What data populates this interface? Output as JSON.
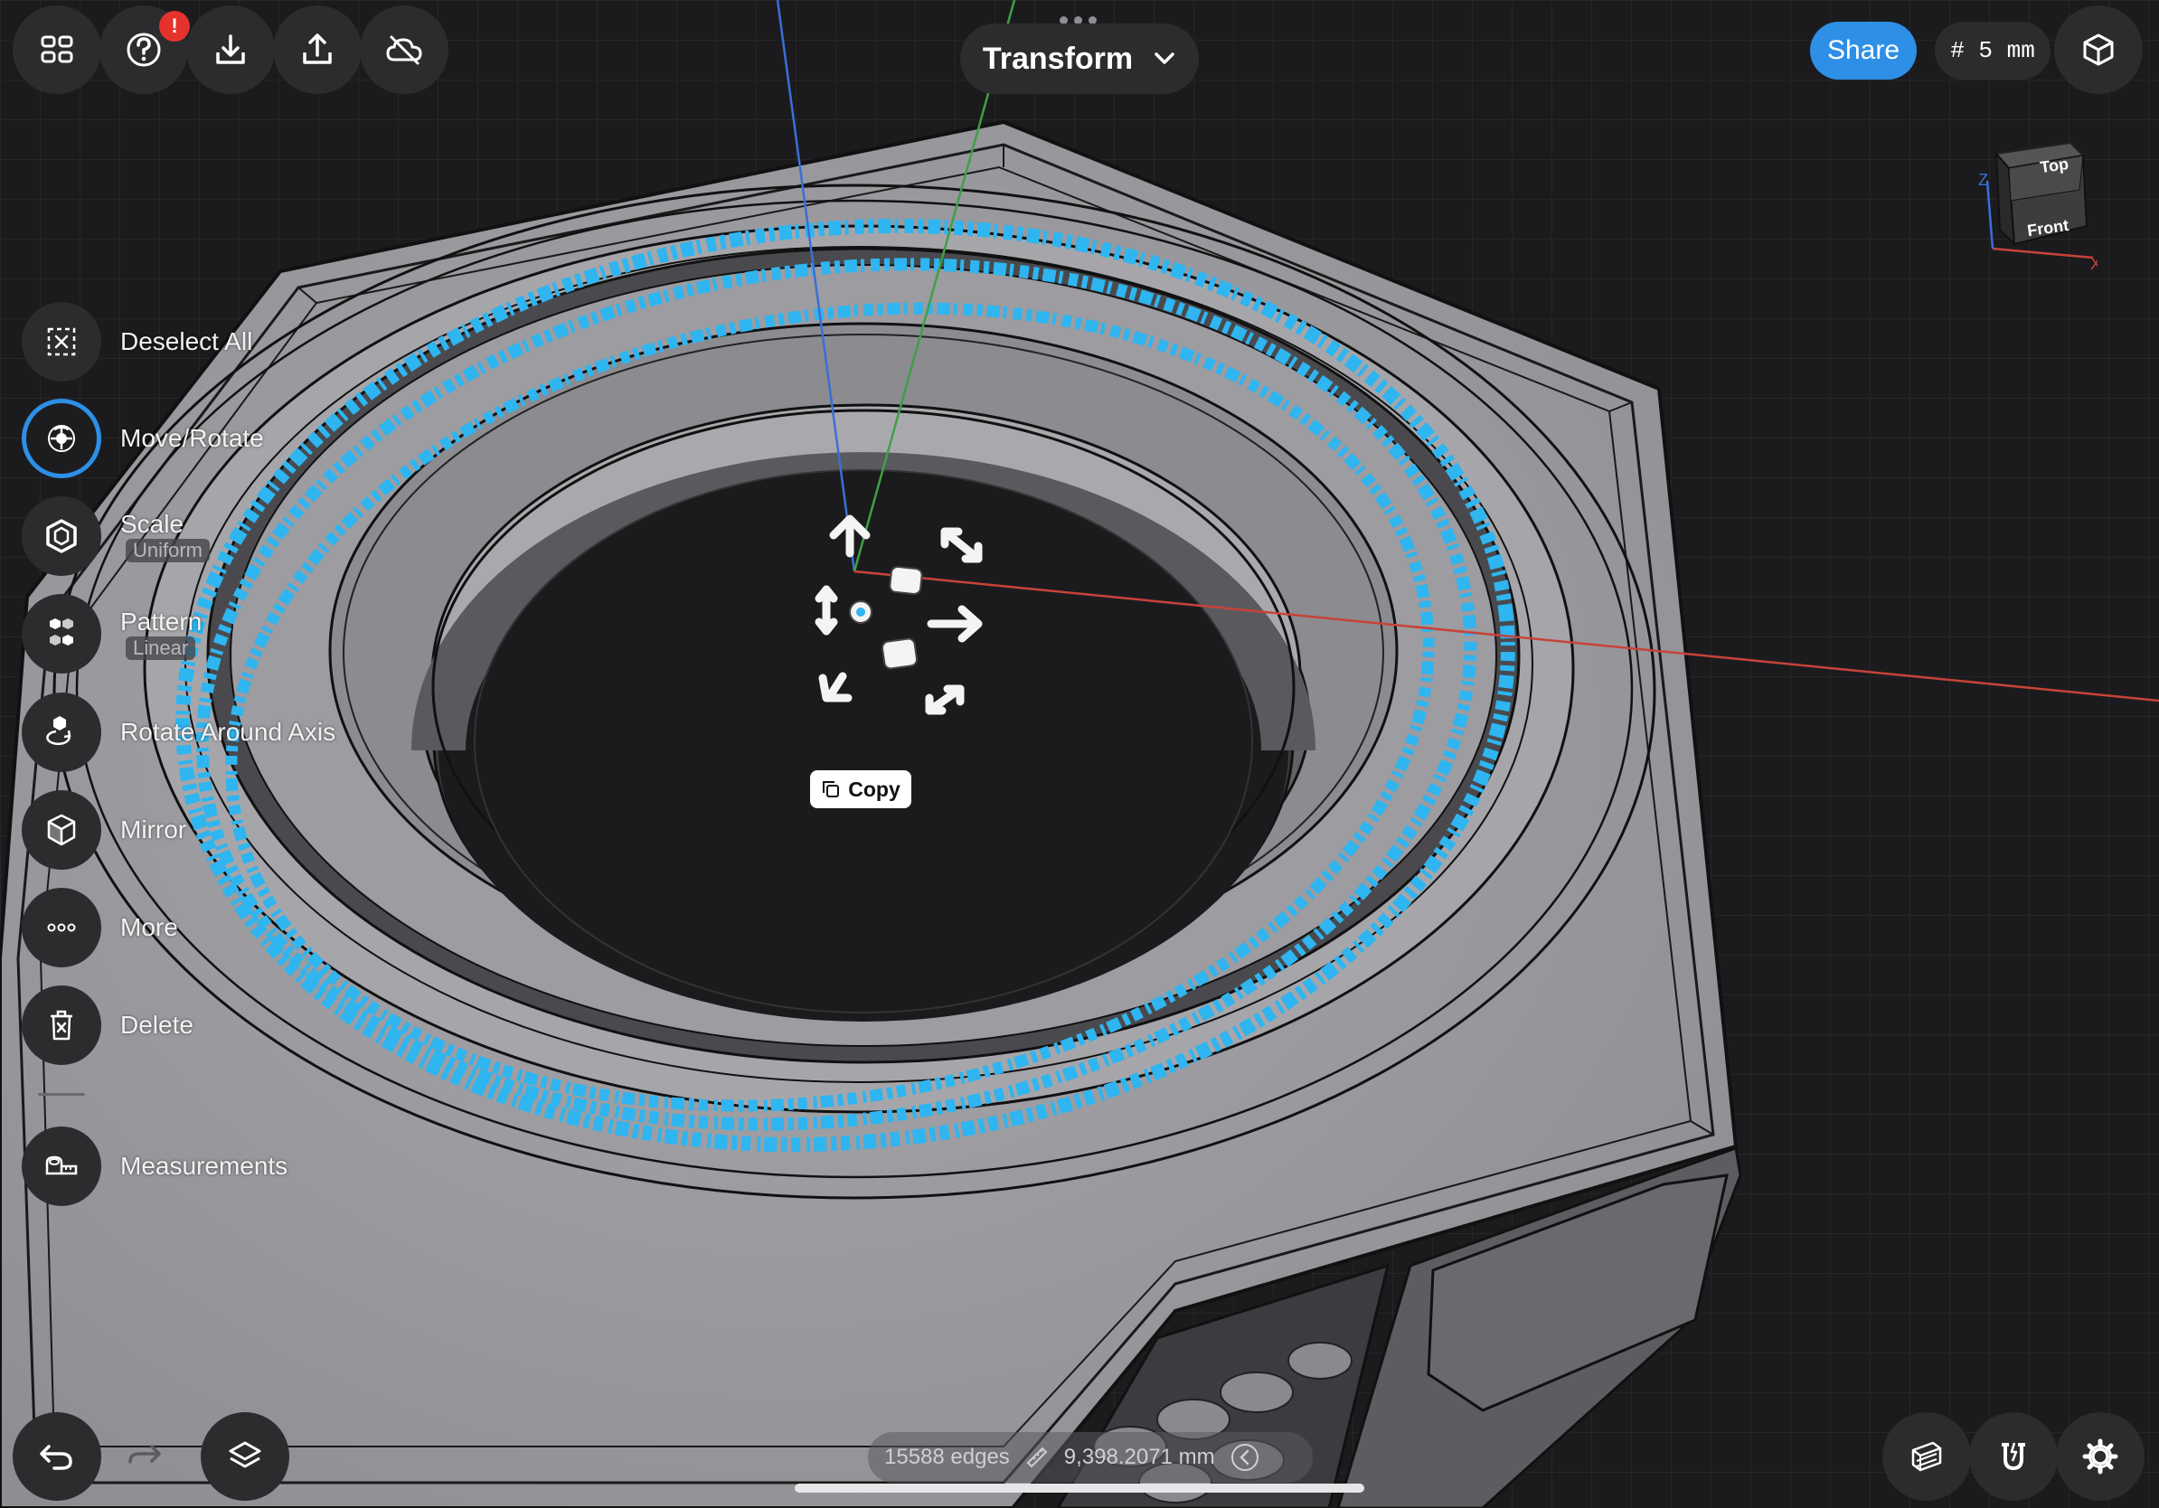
{
  "app": {
    "title": "Transform",
    "notification_badge": "!"
  },
  "top_bar": {
    "share_label": "Share",
    "grid_label": "# 5 mm",
    "left_icons": [
      "grid-icon",
      "help-icon",
      "import-icon",
      "export-icon",
      "cloud-icon"
    ],
    "right_icon": "view-mode-icon"
  },
  "view_cube": {
    "top_label": "Top",
    "front_label": "Front",
    "axis_x": "X",
    "axis_z": "Z"
  },
  "tools": [
    {
      "label": "Deselect All",
      "icon": "deselect-icon",
      "active": false
    },
    {
      "label": "Move/Rotate",
      "icon": "move-rotate-icon",
      "active": true
    },
    {
      "label": "Scale",
      "sub": "Uniform",
      "icon": "scale-icon",
      "active": false
    },
    {
      "label": "Pattern",
      "sub": "Linear",
      "icon": "pattern-icon",
      "active": false
    },
    {
      "label": "Rotate Around Axis",
      "icon": "rotate-axis-icon",
      "active": false
    },
    {
      "label": "Mirror",
      "icon": "mirror-icon",
      "active": false
    },
    {
      "label": "More",
      "icon": "more-icon",
      "active": false
    },
    {
      "label": "Delete",
      "icon": "delete-icon",
      "active": false
    },
    {
      "label": "Measurements",
      "icon": "measurements-icon",
      "active": false
    }
  ],
  "gizmo": {
    "copy_label": "Copy"
  },
  "status": {
    "edges": "15588 edges",
    "length": "9,398.2071 mm"
  },
  "bottom": {
    "left_icons": [
      "undo-icon",
      "redo-icon",
      "layers-icon"
    ],
    "right_icons": [
      "section-icon",
      "snap-icon",
      "settings-icon"
    ]
  },
  "colors": {
    "accent": "#2d8fe6",
    "selection": "#2fb5f0",
    "axis_x": "#c8423a",
    "axis_y": "#3fa046",
    "axis_z": "#3a6fd8"
  }
}
